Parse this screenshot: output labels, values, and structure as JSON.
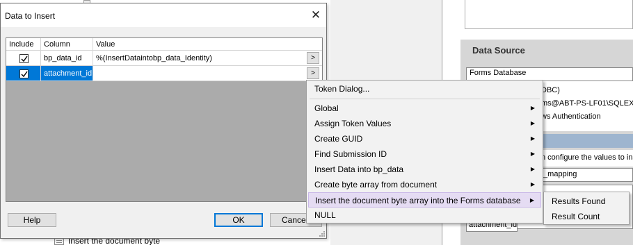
{
  "dialog": {
    "title": "Data to Insert",
    "close_glyph": "✕",
    "columns": [
      "Include",
      "Column",
      "Value"
    ],
    "rows": [
      {
        "include": true,
        "column": "bp_data_id",
        "value": "%(InsertDataintobp_data_Identity)",
        "selected": false
      },
      {
        "include": true,
        "column": "attachment_id",
        "value": "",
        "selected": true
      }
    ],
    "ellipsis_label": ">",
    "buttons": {
      "help": "Help",
      "ok": "OK",
      "cancel": "Cancel"
    }
  },
  "context_menu": {
    "items": [
      {
        "label": "Token Dialog...",
        "submenu": false
      },
      {
        "label": "Global",
        "submenu": true
      },
      {
        "label": "Assign Token Values",
        "submenu": true
      },
      {
        "label": "Create GUID",
        "submenu": true
      },
      {
        "label": "Find Submission ID",
        "submenu": true
      },
      {
        "label": "Insert Data into bp_data",
        "submenu": true
      },
      {
        "label": "Create byte array from document",
        "submenu": true
      },
      {
        "label": "Insert the document byte array into the Forms database",
        "submenu": true,
        "highlighted": true
      },
      {
        "label": "NULL",
        "submenu": false
      }
    ],
    "submenu_items": [
      "Results Found",
      "Result Count"
    ],
    "arrow_glyph": "▶"
  },
  "background": {
    "tree_bottom_label": "Insert the document byte",
    "right_panel": {
      "data_source_title": "Data Source",
      "data_source_value": "Forms Database",
      "info_line1": "DBC)",
      "info_line2": "ms@ABT-PS-LF01\\SQLEX",
      "info_line3": "ws Authentication",
      "configure_text": "n configure the values to ins",
      "mapping_text": "t_mapping",
      "grid_cell": "attachment_id"
    }
  },
  "colors": {
    "selection": "#0078d7",
    "menu_highlight": "#e5dcf3",
    "dialog_bg": "#f0f0f0",
    "grid_bg": "#ababab"
  }
}
